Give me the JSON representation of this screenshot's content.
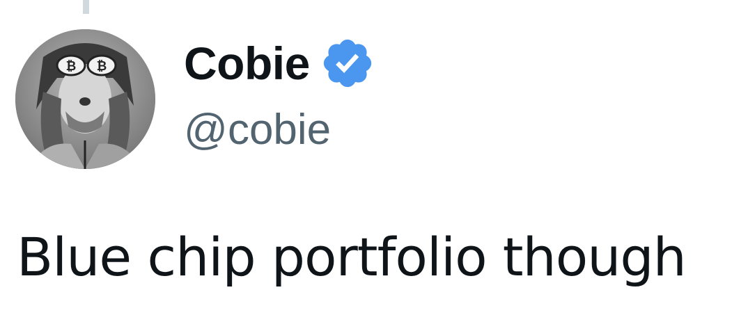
{
  "tweet": {
    "author": {
      "display_name": "Cobie",
      "handle": "@cobie",
      "verified": true,
      "verified_badge_color": "#4b97f0",
      "avatar_icon": "avatar-photo"
    },
    "text": "Blue chip portfolio though"
  },
  "colors": {
    "text_primary": "#0f1419",
    "text_secondary": "#536471",
    "thread_line": "#cfd9de",
    "background": "#ffffff"
  }
}
